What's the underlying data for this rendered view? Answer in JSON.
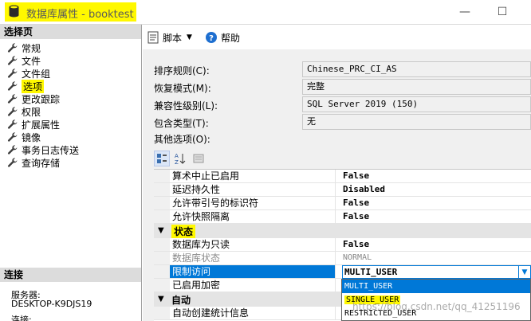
{
  "window": {
    "title": "数据库属性 - booktest",
    "minimize_glyph": "—",
    "maximize_glyph": "☐",
    "highlight_color": "#fff800"
  },
  "left_pane": {
    "header": "选择页",
    "items": [
      {
        "label": "常规",
        "icon": "wrench-icon"
      },
      {
        "label": "文件",
        "icon": "wrench-icon"
      },
      {
        "label": "文件组",
        "icon": "wrench-icon"
      },
      {
        "label": "选项",
        "icon": "wrench-icon",
        "highlighted": true
      },
      {
        "label": "更改跟踪",
        "icon": "wrench-icon"
      },
      {
        "label": "权限",
        "icon": "wrench-icon"
      },
      {
        "label": "扩展属性",
        "icon": "wrench-icon"
      },
      {
        "label": "镜像",
        "icon": "wrench-icon"
      },
      {
        "label": "事务日志传送",
        "icon": "wrench-icon"
      },
      {
        "label": "查询存储",
        "icon": "wrench-icon"
      }
    ],
    "connection": {
      "header": "连接",
      "server_label": "服务器:",
      "server_value": "DESKTOP-K9DJS19",
      "conn_label": "连接:"
    }
  },
  "toolbar": {
    "script_label": "脚本",
    "help_label": "帮助"
  },
  "properties": [
    {
      "label": "排序规则(C):",
      "value": "Chinese_PRC_CI_AS"
    },
    {
      "label": "恢复模式(M):",
      "value": "完整"
    },
    {
      "label": "兼容性级别(L):",
      "value": "SQL Server 2019 (150)"
    },
    {
      "label": "包含类型(T):",
      "value": "无"
    }
  ],
  "other_options_label": "其他选项(O):",
  "grid": {
    "rows_top": [
      {
        "name": "算术中止已启用",
        "value": "False"
      },
      {
        "name": "延迟持久性",
        "value": "Disabled"
      },
      {
        "name": "允许带引号的标识符",
        "value": "False"
      },
      {
        "name": "允许快照隔离",
        "value": "False"
      }
    ],
    "category_state": "状态",
    "rows_state": [
      {
        "name": "数据库为只读",
        "value": "False"
      },
      {
        "name": "数据库状态",
        "value": "NORMAL"
      }
    ],
    "restrict_access": {
      "name": "限制访问",
      "value": "MULTI_USER"
    },
    "encryption": {
      "name": "已启用加密"
    },
    "category_auto": "自动",
    "auto_stats": {
      "name": "自动创建统计信息"
    }
  },
  "dropdown": {
    "options": [
      "MULTI_USER",
      "SINGLE_USER",
      "RESTRICTED_USER"
    ],
    "selected": "MULTI_USER"
  },
  "watermark": "https://blog.csdn.net/qq_41251196"
}
